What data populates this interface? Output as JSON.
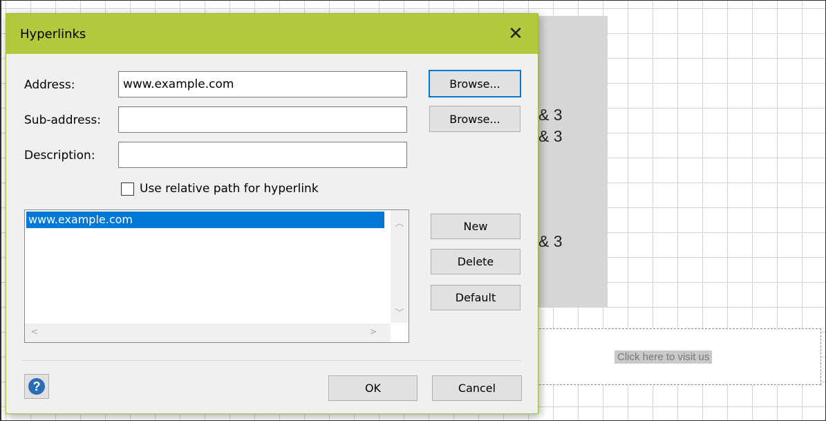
{
  "background": {
    "shape_text": [
      "& 3",
      "& 3",
      "& 3"
    ],
    "link_text": "Click here to visit us"
  },
  "dialog": {
    "title": "Hyperlinks",
    "close_icon": "close-icon",
    "address": {
      "label": "Address:",
      "value": "www.example.com",
      "browse_label": "Browse..."
    },
    "sub_address": {
      "label": "Sub-address:",
      "value": "",
      "browse_label": "Browse..."
    },
    "description": {
      "label": "Description:",
      "value": ""
    },
    "relative_path": {
      "label": "Use relative path for hyperlink",
      "checked": false
    },
    "hyperlinks_list": [
      "www.example.com"
    ],
    "buttons": {
      "new": "New",
      "delete": "Delete",
      "default": "Default",
      "ok": "OK",
      "cancel": "Cancel"
    },
    "help_icon": "help-icon",
    "accent_color": "#b2c83d",
    "selection_color": "#0078d7"
  }
}
